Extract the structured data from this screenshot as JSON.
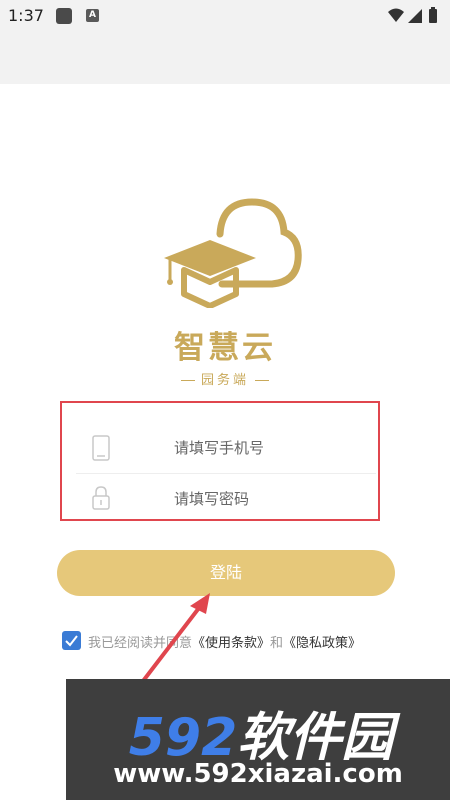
{
  "status_bar": {
    "time": "1:37",
    "app_icon_letter": "A"
  },
  "brand": {
    "name": "智慧云",
    "subtitle": "园务端",
    "color": "#c9a95a"
  },
  "form": {
    "phone_placeholder": "请填写手机号",
    "password_placeholder": "请填写密码",
    "highlight_color": "#e0464e"
  },
  "login": {
    "label": "登陆",
    "color": "#e6c87a"
  },
  "agreement": {
    "checked": true,
    "text": "我已经阅读并同意",
    "terms": "《使用条款》",
    "and": "和",
    "privacy": "《隐私政策》"
  },
  "watermark": {
    "logo_num": "592",
    "logo_text": "软件园",
    "url": "www.592xiazai.com"
  }
}
